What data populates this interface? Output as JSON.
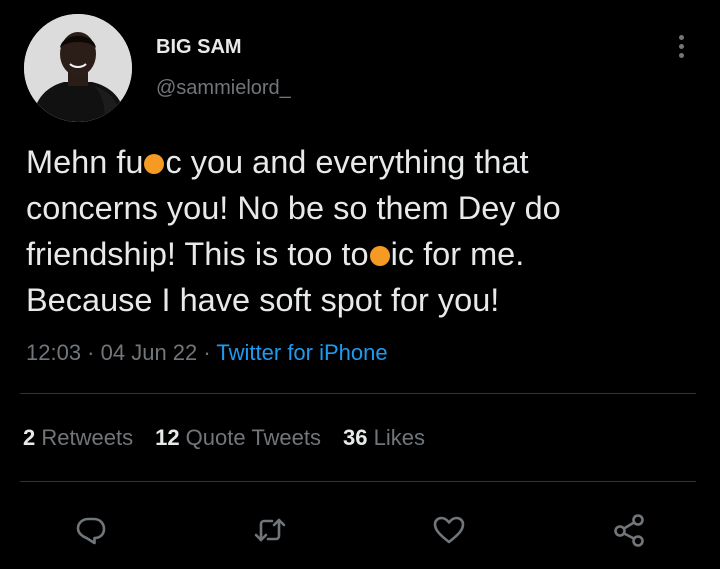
{
  "author": {
    "name": "BIG SAM",
    "handle": "@sammielord_"
  },
  "tweet": {
    "line1_pre": "Mehn fu",
    "line1_post": "c you and everything that",
    "line2": "concerns you! No be so them Dey do",
    "line3_pre": "friendship! This is too to",
    "line3_post": "ic for me.",
    "line4": "Because I have soft spot for you!",
    "censor_color": "#f59a23"
  },
  "meta": {
    "time": "12:03",
    "separator1": " · ",
    "date": "04 Jun 22",
    "separator2": " · ",
    "source": "Twitter for iPhone"
  },
  "stats": {
    "retweets_count": "2",
    "retweets_label": " Retweets",
    "quotes_count": "12",
    "quotes_label": " Quote Tweets",
    "likes_count": "36",
    "likes_label": " Likes"
  },
  "actions": {
    "reply": "reply-icon",
    "retweet": "retweet-icon",
    "like": "heart-icon",
    "share": "share-icon"
  },
  "colors": {
    "background": "#000000",
    "text_primary": "#e7e9ea",
    "text_secondary": "#71767b",
    "link": "#1d9bf0",
    "divider": "#2f3336"
  }
}
